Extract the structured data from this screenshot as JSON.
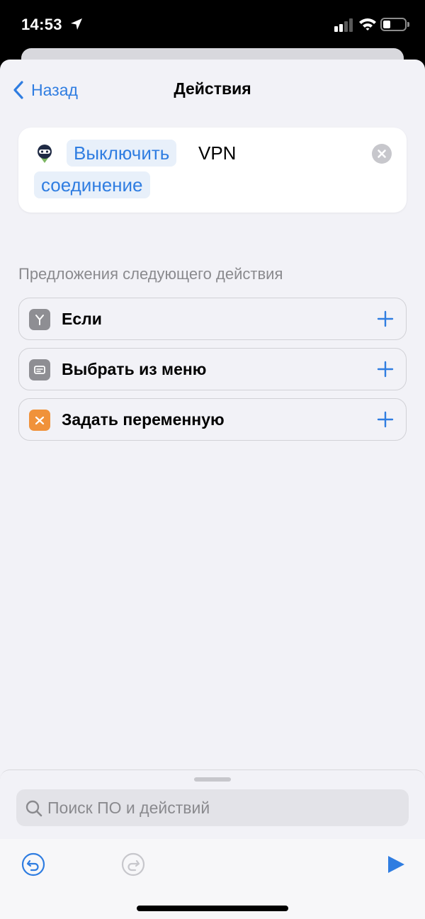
{
  "status_bar": {
    "time": "14:53",
    "battery_level": 0.35,
    "signal_bars": 2,
    "icons": [
      "location-arrow-icon",
      "cellular-signal-icon",
      "wifi-icon",
      "battery-icon"
    ]
  },
  "nav": {
    "back_label": "Назад",
    "title": "Действия"
  },
  "action": {
    "app_icon": "vpn-app-icon",
    "token_verb": "Выключить",
    "static_word": "VPN",
    "token_object": "соединение",
    "clear_icon": "clear-icon"
  },
  "suggestions": {
    "header": "Предложения следующего действия",
    "items": [
      {
        "label": "Если",
        "icon": "if-branch-icon",
        "icon_color": "#8e8e93"
      },
      {
        "label": "Выбрать из меню",
        "icon": "menu-icon",
        "icon_color": "#8e8e93"
      },
      {
        "label": "Задать переменную",
        "icon": "variable-icon",
        "icon_color": "#f0923a"
      }
    ]
  },
  "search": {
    "placeholder": "Поиск ПО и действий"
  },
  "toolbar": {
    "undo_icon": "undo-icon",
    "redo_icon": "redo-icon",
    "run_icon": "play-icon"
  },
  "colors": {
    "accent": "#2f7de1",
    "background": "#f2f2f7",
    "token_bg": "#e8f0fa"
  }
}
